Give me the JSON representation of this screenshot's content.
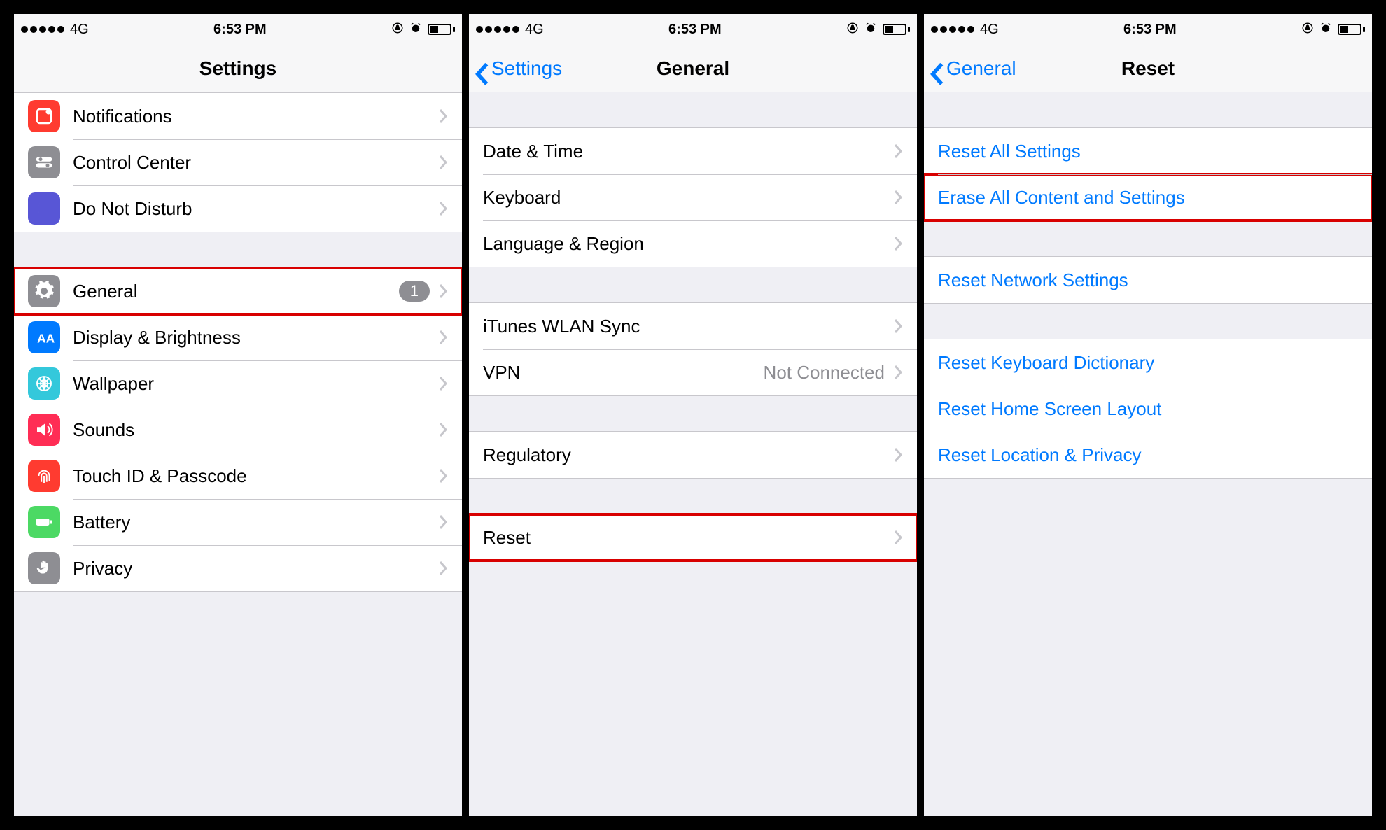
{
  "status": {
    "network": "4G",
    "time": "6:53 PM"
  },
  "screen1": {
    "title": "Settings",
    "rows": {
      "notifications": "Notifications",
      "controlCenter": "Control Center",
      "dnd": "Do Not Disturb",
      "general": "General",
      "generalBadge": "1",
      "display": "Display & Brightness",
      "wallpaper": "Wallpaper",
      "sounds": "Sounds",
      "touchid": "Touch ID & Passcode",
      "battery": "Battery",
      "privacy": "Privacy"
    }
  },
  "screen2": {
    "back": "Settings",
    "title": "General",
    "rows": {
      "datetime": "Date & Time",
      "keyboard": "Keyboard",
      "language": "Language & Region",
      "itunes": "iTunes WLAN Sync",
      "vpn": "VPN",
      "vpnDetail": "Not Connected",
      "regulatory": "Regulatory",
      "reset": "Reset"
    }
  },
  "screen3": {
    "back": "General",
    "title": "Reset",
    "rows": {
      "resetAll": "Reset All Settings",
      "eraseAll": "Erase All Content and Settings",
      "resetNetwork": "Reset Network Settings",
      "resetKeyboard": "Reset Keyboard Dictionary",
      "resetHome": "Reset Home Screen Layout",
      "resetLocation": "Reset Location & Privacy"
    }
  }
}
